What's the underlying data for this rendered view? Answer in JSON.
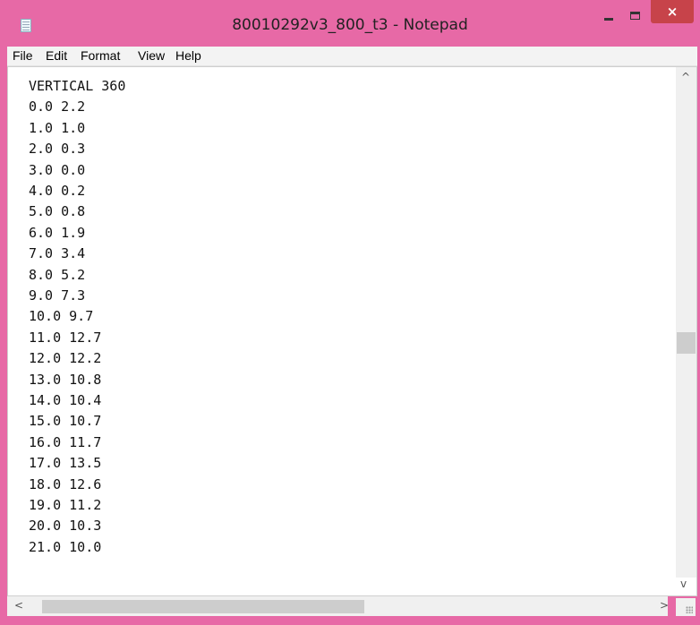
{
  "window": {
    "title": "80010292v3_800_t3 - Notepad",
    "close_glyph": "×",
    "frame_color": "#e769a6",
    "close_color": "#c7434a"
  },
  "menu": {
    "items": [
      "File",
      "Edit",
      "Format",
      "View",
      "Help"
    ]
  },
  "document": {
    "lines": [
      "VERTICAL 360",
      "0.0 2.2",
      "1.0 1.0",
      "2.0 0.3",
      "3.0 0.0",
      "4.0 0.2",
      "5.0 0.8",
      "6.0 1.9",
      "7.0 3.4",
      "8.0 5.2",
      "9.0 7.3",
      "10.0 9.7",
      "11.0 12.7",
      "12.0 12.2",
      "13.0 10.8",
      "14.0 10.4",
      "15.0 10.7",
      "16.0 11.7",
      "17.0 13.5",
      "18.0 12.6",
      "19.0 11.2",
      "20.0 10.3",
      "21.0 10.0"
    ]
  },
  "scrollbars": {
    "up_arrow": "^",
    "down_arrow": "v",
    "left_arrow": "<",
    "right_arrow": ">"
  }
}
